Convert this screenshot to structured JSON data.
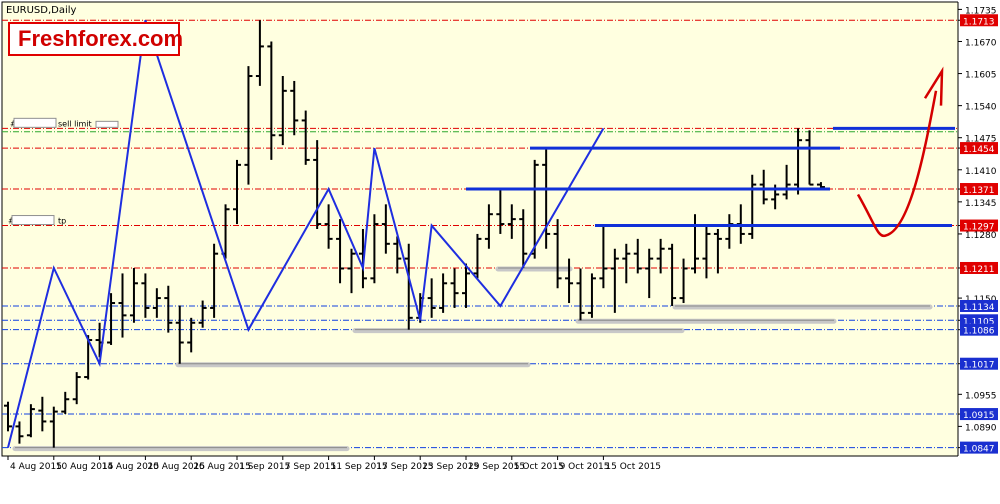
{
  "chart_data": {
    "type": "candlestick",
    "title": "EURUSD,Daily",
    "symbol": "EURUSD",
    "timeframe": "Daily",
    "watermark": "Freshforex.com",
    "ylim": [
      1.083,
      1.175
    ],
    "colors": {
      "plot_background": "#ffffe0",
      "price_bars": "#000000",
      "zigzag": "#1f2ee0",
      "level_red": "#e00000",
      "level_blue": "#1040e0",
      "label_red_bg": "#e00000",
      "label_blue_bg": "#1a2fd0",
      "projection_arrow": "#d40000"
    },
    "y_ticks": [
      "1.1735",
      "1.1713",
      "1.1670",
      "1.1605",
      "1.1540",
      "1.1475",
      "1.1454",
      "1.1410",
      "1.1371",
      "1.1345",
      "1.1297",
      "1.1280",
      "1.1211",
      "1.1150",
      "1.1134",
      "1.1105",
      "1.1086",
      "1.1017",
      "1.0955",
      "1.0915",
      "1.0890",
      "1.0847"
    ],
    "x_ticks": [
      "4 Aug 2015",
      "10 Aug 2015",
      "14 Aug 2015",
      "20 Aug 2015",
      "26 Aug 2015",
      "1 Sep 2015",
      "7 Sep 2015",
      "11 Sep 2015",
      "17 Sep 2015",
      "23 Sep 2015",
      "29 Sep 2015",
      "5 Oct 2015",
      "9 Oct 2015",
      "15 Oct 2015"
    ],
    "levels": [
      {
        "price": "1.1713",
        "value": 1.1713,
        "color": "red",
        "style": "dash-dot"
      },
      {
        "price": "1.1494",
        "value": 1.1494,
        "color": "red",
        "style": "dash-dot"
      },
      {
        "price": "1.1454",
        "value": 1.1454,
        "color": "red",
        "style": "dash-dot"
      },
      {
        "price": "1.1371",
        "value": 1.1371,
        "color": "red",
        "style": "dash-dot"
      },
      {
        "price": "1.1297",
        "value": 1.1297,
        "color": "red",
        "style": "dash-dot"
      },
      {
        "price": "1.1211",
        "value": 1.1211,
        "color": "red",
        "style": "dash-dot"
      },
      {
        "price": "1.1134",
        "value": 1.1134,
        "color": "blue",
        "style": "dash-dot"
      },
      {
        "price": "1.1105",
        "value": 1.1105,
        "color": "blue",
        "style": "dash-dot"
      },
      {
        "price": "1.1086",
        "value": 1.1086,
        "color": "blue",
        "style": "dash-dot"
      },
      {
        "price": "1.1017",
        "value": 1.1017,
        "color": "blue",
        "style": "dash-dot"
      },
      {
        "price": "1.0915",
        "value": 1.0915,
        "color": "blue",
        "style": "dash-dot"
      },
      {
        "price": "1.0847",
        "value": 1.0847,
        "color": "blue",
        "style": "dash-dot"
      }
    ],
    "order_labels": [
      {
        "text": "sell limit",
        "value": 1.1494
      },
      {
        "text": "tp",
        "value": 1.1297
      }
    ],
    "zigzag": [
      {
        "date": "4 Aug 2015",
        "price": 1.0847
      },
      {
        "date": "10 Aug 2015",
        "price": 1.1211
      },
      {
        "date": "14 Aug 2015",
        "price": 1.1017
      },
      {
        "date": "20 Aug 2015",
        "price": 1.1713
      },
      {
        "date": "2 Sep 2015",
        "price": 1.1086
      },
      {
        "date": "11 Sep 2015",
        "price": 1.1371
      },
      {
        "date": "16 Sep 2015",
        "price": 1.1211
      },
      {
        "date": "17 Sep 2015",
        "price": 1.1454
      },
      {
        "date": "23 Sep 2015",
        "price": 1.1105
      },
      {
        "date": "24 Sep 2015",
        "price": 1.1297
      },
      {
        "date": "2 Oct 2015",
        "price": 1.1134
      },
      {
        "date": "15 Oct 2015",
        "price": 1.1494
      }
    ],
    "ohlc": [
      [
        1.0932,
        1.094,
        1.088,
        1.089
      ],
      [
        1.089,
        1.09,
        1.0855,
        1.087
      ],
      [
        1.0872,
        1.0935,
        1.0868,
        1.0925
      ],
      [
        1.0922,
        1.095,
        1.088,
        1.09
      ],
      [
        1.09,
        1.093,
        1.0847,
        1.092
      ],
      [
        1.092,
        1.096,
        1.0915,
        1.0945
      ],
      [
        1.0945,
        1.1,
        1.0935,
        1.099
      ],
      [
        1.099,
        1.1075,
        1.0985,
        1.1065
      ],
      [
        1.1065,
        1.11,
        1.103,
        1.106
      ],
      [
        1.106,
        1.116,
        1.1055,
        1.114
      ],
      [
        1.114,
        1.12,
        1.107,
        1.1115
      ],
      [
        1.1115,
        1.1211,
        1.11,
        1.118
      ],
      [
        1.118,
        1.12,
        1.111,
        1.113
      ],
      [
        1.113,
        1.117,
        1.111,
        1.115
      ],
      [
        1.115,
        1.1175,
        1.108,
        1.11
      ],
      [
        1.11,
        1.1135,
        1.1017,
        1.106
      ],
      [
        1.106,
        1.111,
        1.104,
        1.11
      ],
      [
        1.11,
        1.1145,
        1.109,
        1.113
      ],
      [
        1.113,
        1.126,
        1.111,
        1.124
      ],
      [
        1.124,
        1.134,
        1.123,
        1.133
      ],
      [
        1.133,
        1.143,
        1.13,
        1.142
      ],
      [
        1.142,
        1.162,
        1.138,
        1.16
      ],
      [
        1.16,
        1.1713,
        1.158,
        1.166
      ],
      [
        1.166,
        1.167,
        1.143,
        1.148
      ],
      [
        1.148,
        1.16,
        1.146,
        1.157
      ],
      [
        1.157,
        1.159,
        1.148,
        1.151
      ],
      [
        1.151,
        1.153,
        1.142,
        1.143
      ],
      [
        1.143,
        1.147,
        1.129,
        1.13
      ],
      [
        1.13,
        1.134,
        1.125,
        1.127
      ],
      [
        1.127,
        1.131,
        1.118,
        1.121
      ],
      [
        1.121,
        1.125,
        1.116,
        1.124
      ],
      [
        1.124,
        1.129,
        1.117,
        1.119
      ],
      [
        1.119,
        1.132,
        1.118,
        1.13
      ],
      [
        1.13,
        1.134,
        1.124,
        1.126
      ],
      [
        1.126,
        1.1275,
        1.12,
        1.123
      ],
      [
        1.123,
        1.126,
        1.1086,
        1.111
      ],
      [
        1.111,
        1.116,
        1.11,
        1.115
      ],
      [
        1.115,
        1.119,
        1.111,
        1.113
      ],
      [
        1.113,
        1.12,
        1.112,
        1.118
      ],
      [
        1.118,
        1.121,
        1.113,
        1.116
      ],
      [
        1.116,
        1.122,
        1.113,
        1.12
      ],
      [
        1.12,
        1.128,
        1.119,
        1.127
      ],
      [
        1.127,
        1.134,
        1.125,
        1.132
      ],
      [
        1.132,
        1.1371,
        1.128,
        1.13
      ],
      [
        1.13,
        1.134,
        1.127,
        1.131
      ],
      [
        1.131,
        1.133,
        1.1211,
        1.124
      ],
      [
        1.124,
        1.143,
        1.123,
        1.142
      ],
      [
        1.142,
        1.1454,
        1.125,
        1.128
      ],
      [
        1.128,
        1.131,
        1.117,
        1.119
      ],
      [
        1.119,
        1.123,
        1.114,
        1.118
      ],
      [
        1.118,
        1.121,
        1.1105,
        1.112
      ],
      [
        1.112,
        1.12,
        1.111,
        1.119
      ],
      [
        1.119,
        1.1297,
        1.117,
        1.121
      ],
      [
        1.121,
        1.125,
        1.112,
        1.123
      ],
      [
        1.123,
        1.126,
        1.118,
        1.124
      ],
      [
        1.124,
        1.127,
        1.12,
        1.121
      ],
      [
        1.121,
        1.125,
        1.115,
        1.123
      ],
      [
        1.123,
        1.127,
        1.12,
        1.125
      ],
      [
        1.125,
        1.126,
        1.1134,
        1.115
      ],
      [
        1.115,
        1.123,
        1.114,
        1.121
      ],
      [
        1.121,
        1.132,
        1.12,
        1.123
      ],
      [
        1.123,
        1.13,
        1.119,
        1.128
      ],
      [
        1.128,
        1.129,
        1.12,
        1.127
      ],
      [
        1.127,
        1.132,
        1.125,
        1.13
      ],
      [
        1.13,
        1.134,
        1.126,
        1.128
      ],
      [
        1.128,
        1.14,
        1.127,
        1.138
      ],
      [
        1.138,
        1.141,
        1.134,
        1.135
      ],
      [
        1.135,
        1.138,
        1.133,
        1.136
      ],
      [
        1.136,
        1.142,
        1.135,
        1.138
      ],
      [
        1.138,
        1.1494,
        1.136,
        1.147
      ],
      [
        1.147,
        1.149,
        1.138,
        1.138
      ],
      [
        1.138,
        1.1385,
        1.137,
        1.1375
      ]
    ]
  }
}
